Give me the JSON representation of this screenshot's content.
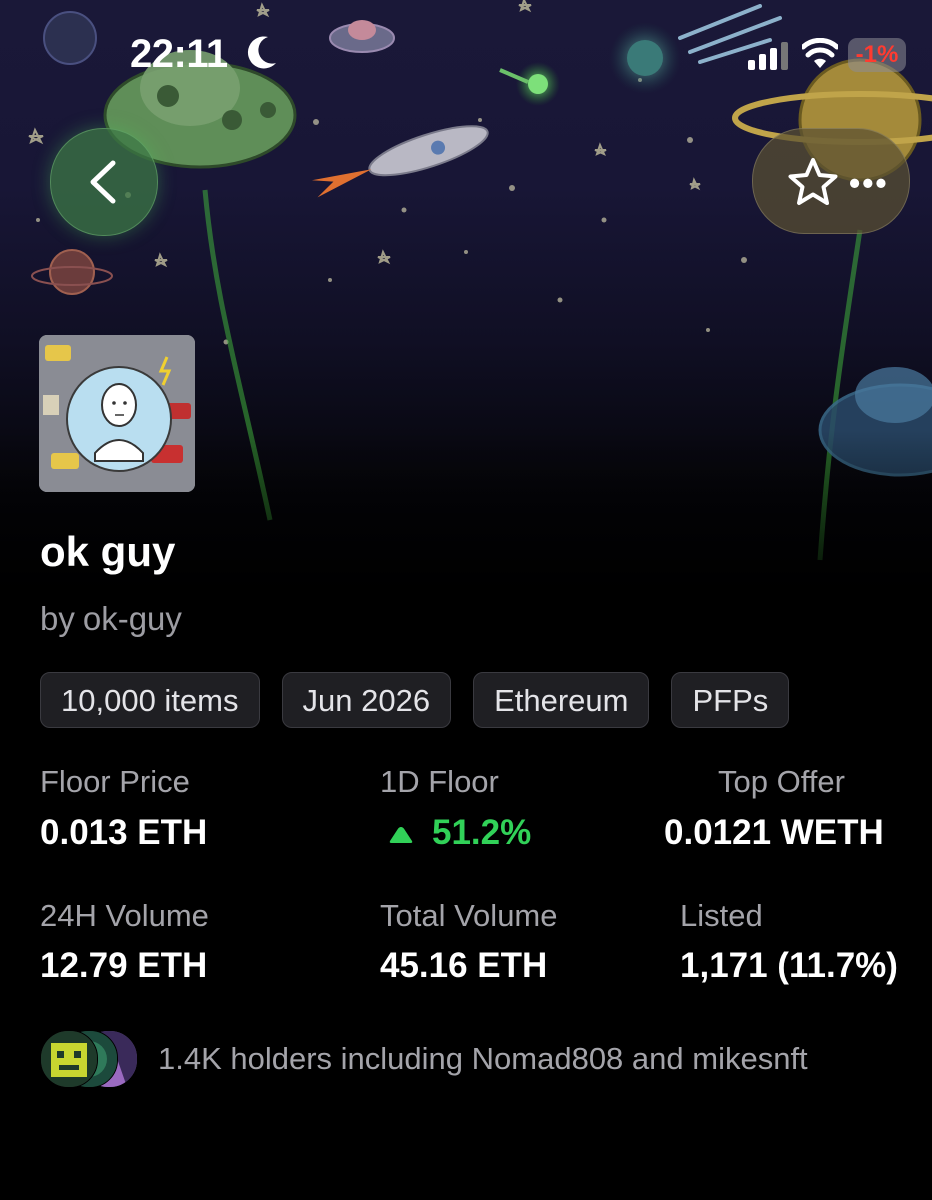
{
  "status_bar": {
    "time": "22:11",
    "battery_label": "-1%"
  },
  "header": {
    "back_icon": "chevron-left-icon",
    "favorite_icon": "star-icon",
    "more_icon": "ellipsis-icon"
  },
  "collection": {
    "name": "ok guy",
    "by_label": "by",
    "creator": "ok-guy",
    "tags": [
      "10,000 items",
      "Jun 2026",
      "Ethereum",
      "PFPs"
    ]
  },
  "stats": {
    "floor_price": {
      "label": "Floor Price",
      "value": "0.013 ETH"
    },
    "floor_1d": {
      "label": "1D Floor",
      "value": "51.2%",
      "direction": "up"
    },
    "top_offer": {
      "label": "Top Offer",
      "value": "0.0121 WETH"
    },
    "volume_24h": {
      "label": "24H Volume",
      "value": "12.79 ETH"
    },
    "total_volume": {
      "label": "Total Volume",
      "value": "45.16 ETH"
    },
    "listed": {
      "label": "Listed",
      "value": "1,171 (11.7%)"
    }
  },
  "holders": {
    "text": "1.4K holders including Nomad808 and mikesnft"
  },
  "colors": {
    "positive": "#31d158",
    "background": "#000000",
    "hero_top": "#1a1838"
  }
}
